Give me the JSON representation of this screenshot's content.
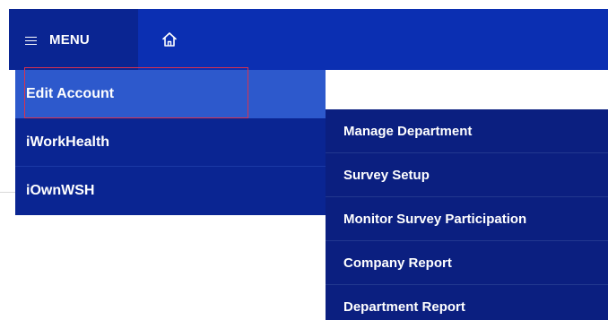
{
  "topbar": {
    "menu_label": "MENU",
    "menu_icon": "hamburger-icon",
    "home_icon": "home-icon",
    "colors": {
      "bar": "#0b2fb2",
      "menu_button": "#0a2592"
    }
  },
  "menu": {
    "items": [
      {
        "label": "Edit Account",
        "active": true
      },
      {
        "label": "iWorkHealth",
        "active": false
      },
      {
        "label": "iOwnWSH",
        "active": false
      }
    ],
    "colors": {
      "panel": "#0a2592",
      "active": "#2d59cc",
      "highlight_border": "#d9324f"
    }
  },
  "submenu": {
    "items": [
      {
        "label": "Manage Department"
      },
      {
        "label": "Survey Setup"
      },
      {
        "label": "Monitor Survey Participation"
      },
      {
        "label": "Company Report"
      },
      {
        "label": "Department Report"
      }
    ],
    "colors": {
      "panel": "#0b1f80"
    }
  }
}
